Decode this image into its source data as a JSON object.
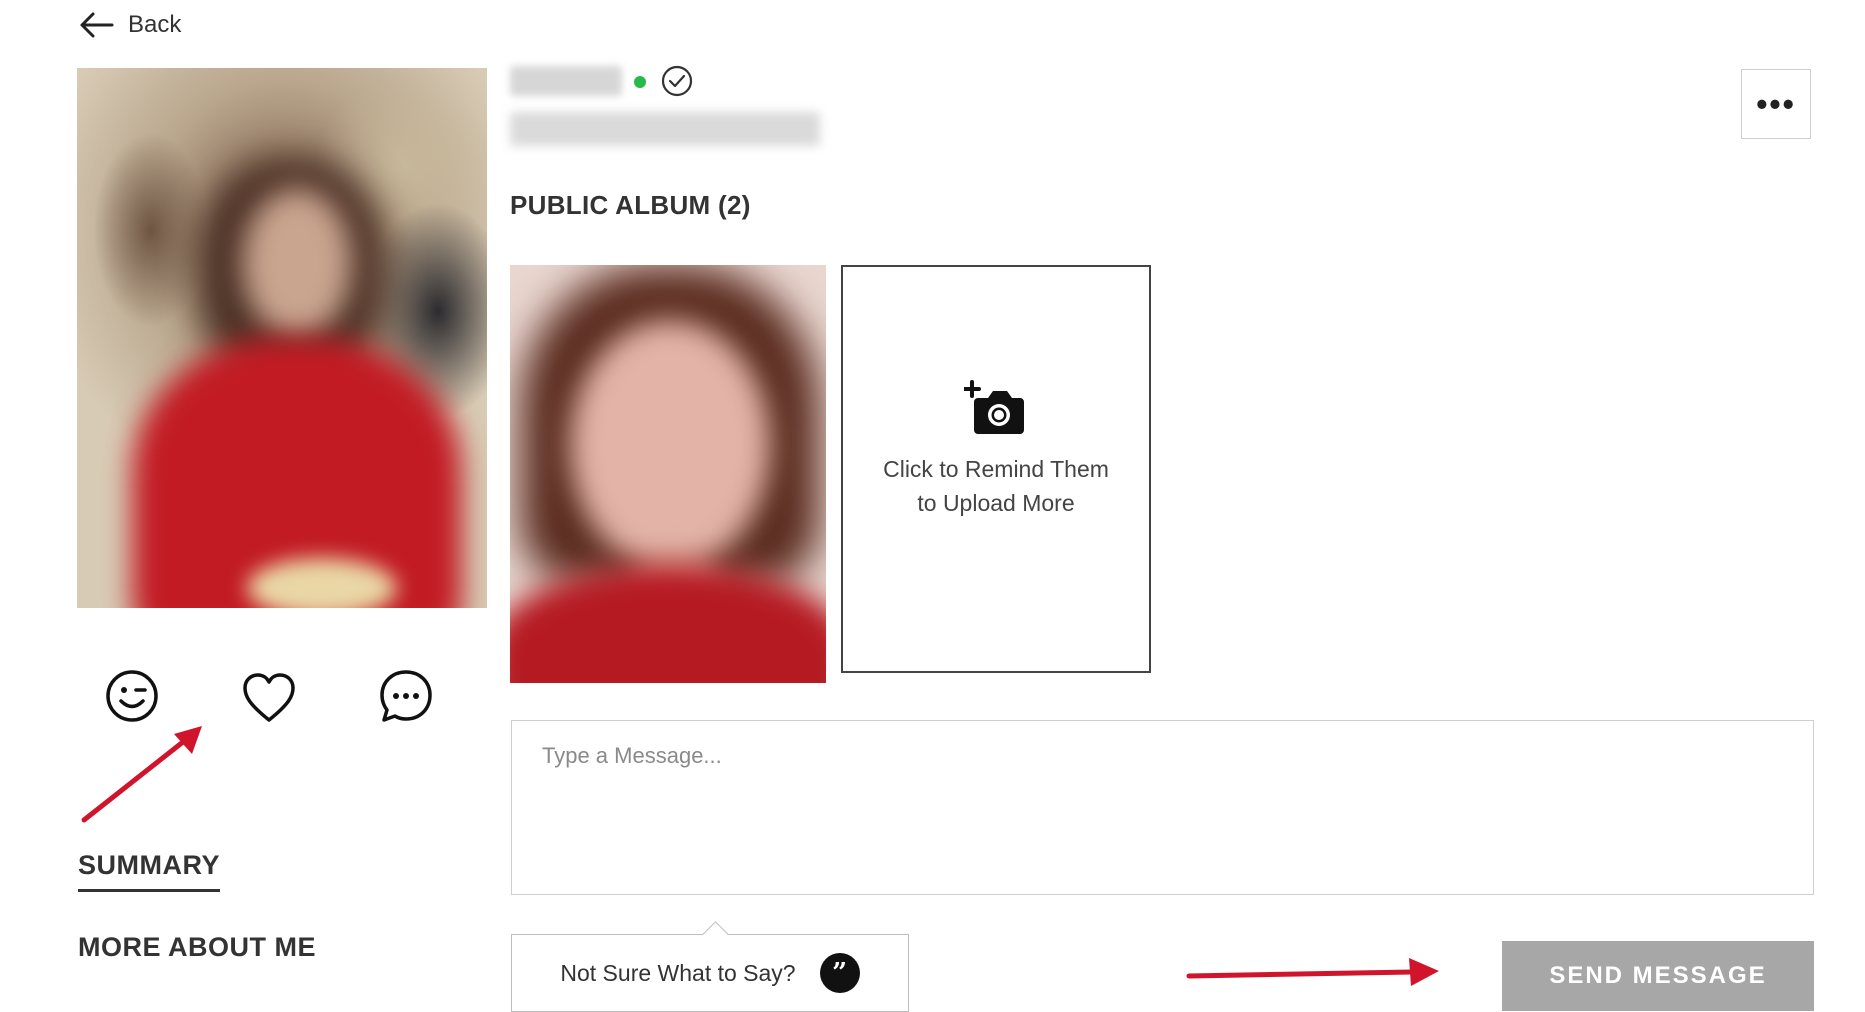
{
  "nav": {
    "back_label": "Back"
  },
  "profile": {
    "status": "online",
    "verified": true,
    "more_label": "•••"
  },
  "album": {
    "title": "PUBLIC ALBUM (2)",
    "upload_line1": "Click to Remind Them",
    "upload_line2": "to Upload More"
  },
  "actions": [
    {
      "name": "wink",
      "icon": "wink-icon"
    },
    {
      "name": "like",
      "icon": "heart-icon"
    },
    {
      "name": "message",
      "icon": "chat-icon"
    }
  ],
  "sections": {
    "summary": "SUMMARY",
    "more_about_me": "MORE ABOUT ME"
  },
  "message": {
    "placeholder": "Type a Message...",
    "suggest_label": "Not Sure What to Say?",
    "send_label": "SEND MESSAGE"
  },
  "colors": {
    "online": "#27b94a",
    "send_disabled": "#a7a7a7",
    "annotation": "#d0142c"
  }
}
